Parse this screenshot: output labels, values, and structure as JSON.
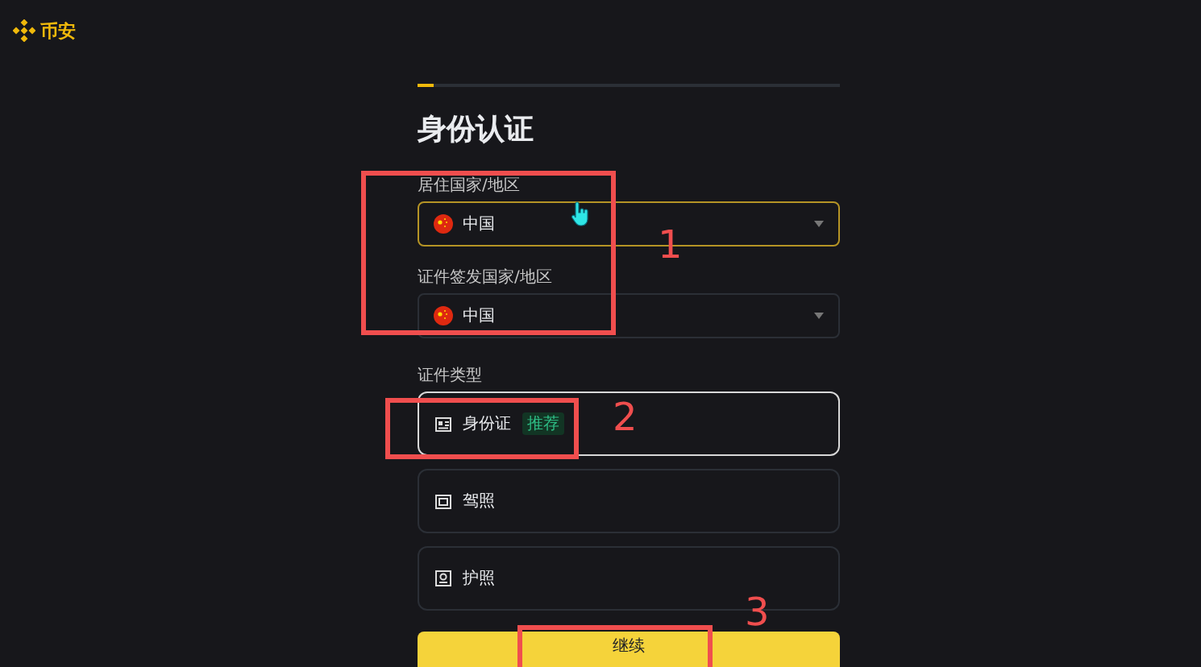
{
  "brand": {
    "name": "币安"
  },
  "progress": {
    "level": 0.04
  },
  "title": "身份认证",
  "fields": [
    {
      "label": "居住国家/地区",
      "value": "中国",
      "focused": true
    },
    {
      "label": "证件签发国家/地区",
      "value": "中国",
      "focused": false
    }
  ],
  "document_type": {
    "label": "证件类型",
    "options": [
      {
        "label": "身份证",
        "badge": "推荐",
        "kind": "idcard",
        "selected": true
      },
      {
        "label": "驾照",
        "kind": "license",
        "selected": false
      },
      {
        "label": "护照",
        "kind": "passport",
        "selected": false
      }
    ]
  },
  "continue_button": "继续",
  "annotations": [
    {
      "number": "1"
    },
    {
      "number": "2"
    },
    {
      "number": "3"
    }
  ]
}
